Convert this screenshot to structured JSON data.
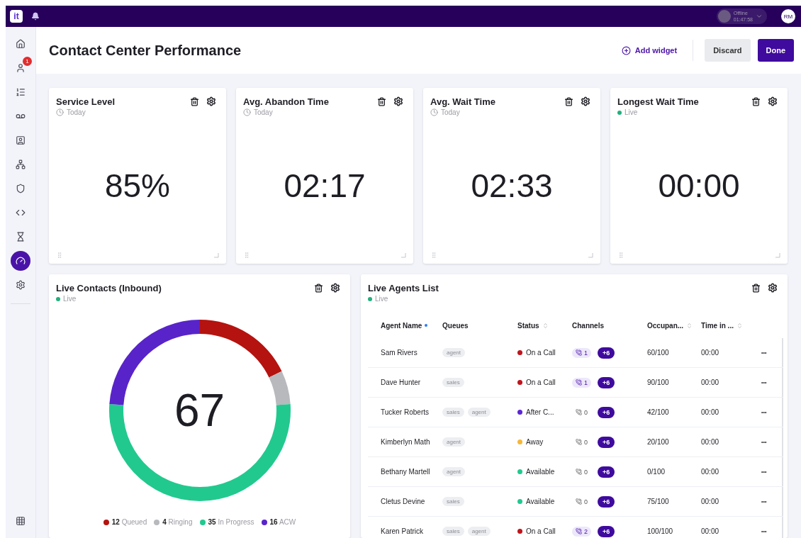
{
  "topbar": {
    "logo": "it",
    "presence": {
      "status": "Offline",
      "timer": "01:47:58"
    },
    "avatar": "RM"
  },
  "sidebar": {
    "items": [
      {
        "kind": "home",
        "selected": false
      },
      {
        "kind": "agent",
        "selected": false,
        "badge": "1"
      },
      {
        "kind": "queue",
        "selected": false
      },
      {
        "kind": "voicemail",
        "selected": false
      },
      {
        "kind": "contact",
        "selected": false
      },
      {
        "kind": "flow",
        "selected": false
      },
      {
        "kind": "shield",
        "selected": false
      },
      {
        "kind": "code",
        "selected": false
      },
      {
        "kind": "hourglass",
        "selected": false
      },
      {
        "kind": "dashboard",
        "selected": true
      },
      {
        "kind": "settings",
        "selected": false
      }
    ],
    "bottom": {
      "kind": "apps"
    }
  },
  "header": {
    "title": "Contact Center Performance",
    "add_widget": "Add widget",
    "discard": "Discard",
    "done": "Done"
  },
  "stat_widgets": [
    {
      "title": "Service Level",
      "period": {
        "kind": "time",
        "label": "Today"
      },
      "value": "85%"
    },
    {
      "title": "Avg. Abandon Time",
      "period": {
        "kind": "time",
        "label": "Today"
      },
      "value": "02:17"
    },
    {
      "title": "Avg. Wait Time",
      "period": {
        "kind": "time",
        "label": "Today"
      },
      "value": "02:33"
    },
    {
      "title": "Longest Wait Time",
      "period": {
        "kind": "live",
        "label": "Live"
      },
      "value": "00:00"
    }
  ],
  "contacts_widget": {
    "title": "Live Contacts (Inbound)",
    "period": {
      "kind": "live",
      "label": "Live"
    },
    "total": "67",
    "chart_data": {
      "type": "donut",
      "categories": [
        "Queued",
        "Ringing",
        "In Progress",
        "ACW"
      ],
      "values": [
        17.91,
        5.97,
        52.24,
        23.88
      ],
      "colors": [
        "#b5130f",
        "#b7b9bd",
        "#22c98f",
        "#5824c9"
      ]
    },
    "legend": [
      {
        "count": "12",
        "color": "#b5130f"
      },
      {
        "count": "4",
        "color": "#b7b9bd"
      },
      {
        "count": "35",
        "color": "#22c98f"
      },
      {
        "count": "16",
        "color": "#5824c9"
      }
    ]
  },
  "agents_widget": {
    "title": "Live Agents List",
    "period": {
      "kind": "live",
      "label": "Live"
    },
    "columns": [
      {
        "label": "Agent Name",
        "sorted": true
      },
      {
        "label": "Queues"
      },
      {
        "label": "Status",
        "sortable": true
      },
      {
        "label": "Channels"
      },
      {
        "label": "Occupan...",
        "sortable": true
      },
      {
        "label": "Time in ...",
        "sortable": true
      }
    ],
    "rows": [
      {
        "name": "Sam Rivers",
        "queues": [
          "agent"
        ],
        "status": "On a Call",
        "color": "#c0141c",
        "calls": "1",
        "active": true,
        "extra": "+6",
        "occupancy": "60/100",
        "time": "00:00",
        "more": "•••"
      },
      {
        "name": "Dave Hunter",
        "queues": [
          "sales"
        ],
        "status": "On a Call",
        "color": "#c0141c",
        "calls": "1",
        "active": true,
        "extra": "+6",
        "occupancy": "90/100",
        "time": "00:00",
        "more": "•••"
      },
      {
        "name": "Tucker Roberts",
        "queues": [
          "sales",
          "agent"
        ],
        "status": "After C...",
        "color": "#5b26d6",
        "calls": "0",
        "active": false,
        "extra": "+6",
        "occupancy": "42/100",
        "time": "00:00",
        "more": "•••"
      },
      {
        "name": "Kimberlyn Math",
        "queues": [
          "agent"
        ],
        "status": "Away",
        "color": "#f4b73a",
        "calls": "0",
        "active": false,
        "extra": "+6",
        "occupancy": "20/100",
        "time": "00:00",
        "more": "•••"
      },
      {
        "name": "Bethany Martell",
        "queues": [
          "agent"
        ],
        "status": "Available",
        "color": "#22c98f",
        "calls": "0",
        "active": false,
        "extra": "+6",
        "occupancy": "0/100",
        "time": "00:00",
        "more": "•••"
      },
      {
        "name": "Cletus Devine",
        "queues": [
          "sales"
        ],
        "status": "Available",
        "color": "#22c98f",
        "calls": "0",
        "active": false,
        "extra": "+6",
        "occupancy": "75/100",
        "time": "00:00",
        "more": "•••"
      },
      {
        "name": "Karen Patrick",
        "queues": [
          "sales",
          "agent"
        ],
        "status": "On a Call",
        "color": "#c0141c",
        "calls": "2",
        "active": true,
        "extra": "+6",
        "occupancy": "100/100",
        "time": "00:00",
        "more": "•••"
      }
    ]
  }
}
